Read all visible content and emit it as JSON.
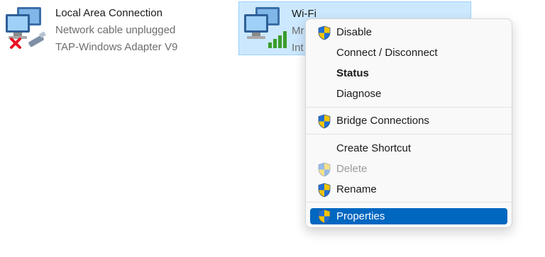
{
  "adapters": {
    "lan": {
      "name": "Local Area Connection",
      "status": "Network cable unplugged",
      "device": "TAP-Windows Adapter V9"
    },
    "wifi": {
      "name": "Wi-Fi",
      "status": "Mr",
      "device": "Int"
    }
  },
  "context_menu": {
    "items": [
      {
        "label": "Disable",
        "shield": true
      },
      {
        "label": "Connect / Disconnect",
        "shield": false
      },
      {
        "label": "Status",
        "shield": false,
        "bold": true
      },
      {
        "label": "Diagnose",
        "shield": false
      },
      {
        "label": "Bridge Connections",
        "shield": true
      },
      {
        "label": "Create Shortcut",
        "shield": false
      },
      {
        "label": "Delete",
        "shield": true,
        "disabled": true
      },
      {
        "label": "Rename",
        "shield": true
      },
      {
        "label": "Properties",
        "shield": true,
        "selected": true
      }
    ]
  },
  "colors": {
    "selection": "#0067c0",
    "wifi_highlight": "#cce8ff",
    "error_x": "#e81123",
    "signal": "#3a9e2b"
  }
}
